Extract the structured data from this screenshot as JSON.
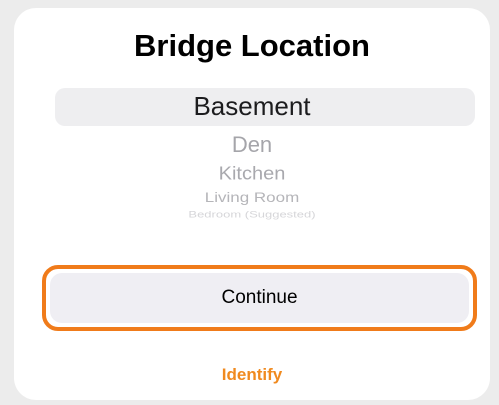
{
  "header": {
    "title": "Bridge Location"
  },
  "picker": {
    "selected": "Basement",
    "items": [
      "Den",
      "Kitchen",
      "Living Room",
      "Bedroom (Suggested)"
    ]
  },
  "actions": {
    "continue_label": "Continue",
    "identify_label": "Identify"
  },
  "colors": {
    "accent": "#f08a1f",
    "focus_outline": "#f07b1a",
    "button_bg": "#efeef3"
  }
}
